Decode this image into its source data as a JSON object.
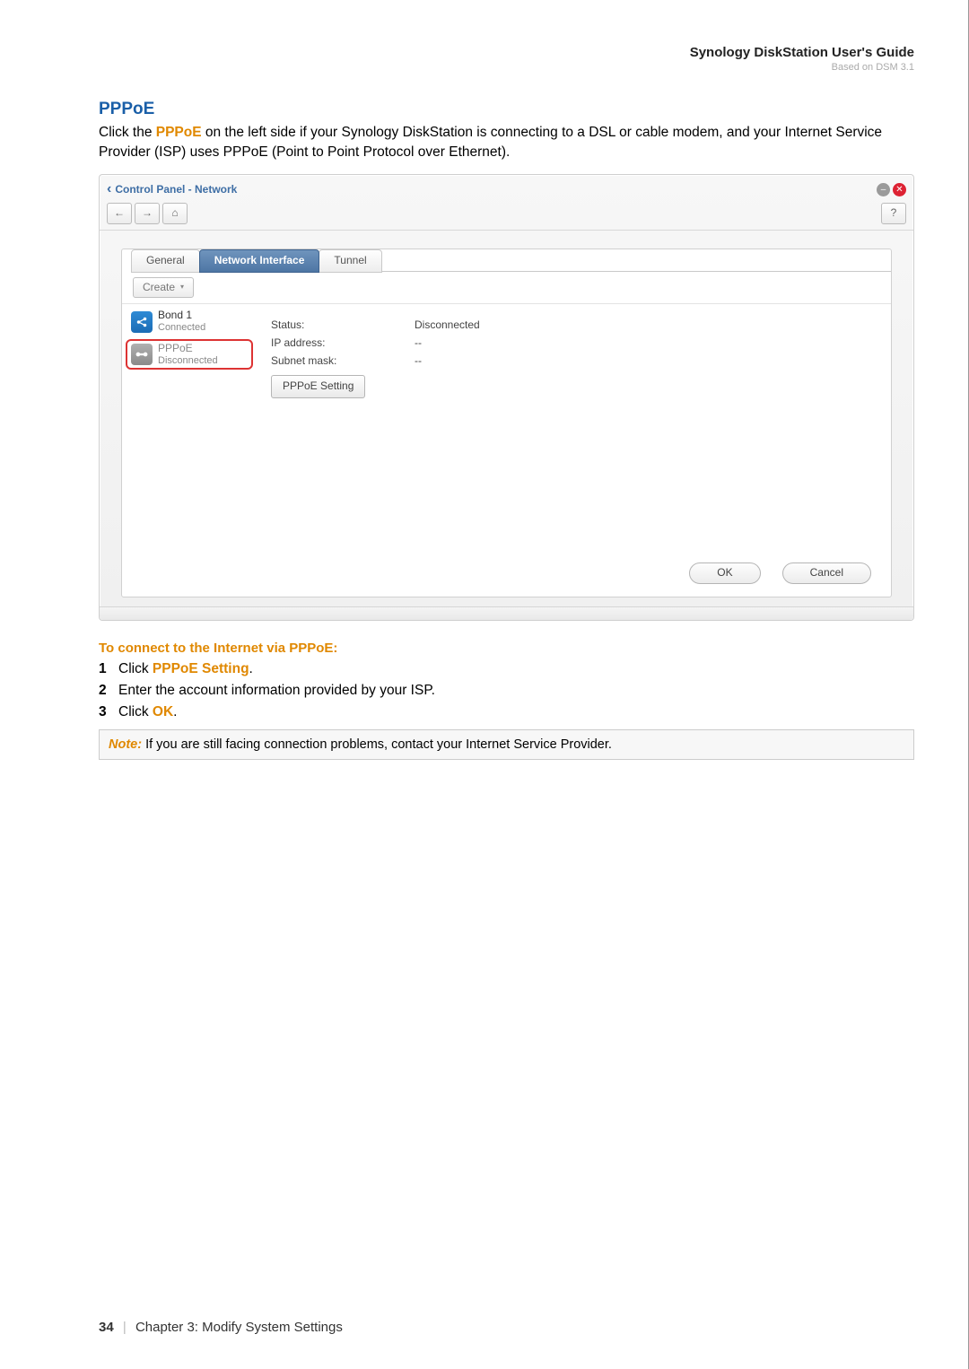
{
  "header": {
    "title": "Synology DiskStation User's Guide",
    "subtitle": "Based on DSM 3.1"
  },
  "section": {
    "title": "PPPoE",
    "intro_pre": "Click the ",
    "intro_link": "PPPoE",
    "intro_post": " on the left side if your Synology DiskStation is connecting to a DSL or cable modem, and your Internet Service Provider (ISP) uses PPPoE (Point to Point Protocol over Ethernet)."
  },
  "window": {
    "title": "Control Panel - Network",
    "tabs": {
      "general": "General",
      "network_interface": "Network Interface",
      "tunnel": "Tunnel"
    },
    "create": "Create",
    "side": {
      "bond": {
        "name": "Bond 1",
        "state": "Connected"
      },
      "pppoe": {
        "name": "PPPoE",
        "state": "Disconnected"
      }
    },
    "fields": {
      "status_label": "Status:",
      "status_value": "Disconnected",
      "ip_label": "IP address:",
      "ip_value": "--",
      "mask_label": "Subnet mask:",
      "mask_value": "--"
    },
    "pppoe_btn": "PPPoE Setting",
    "ok": "OK",
    "cancel": "Cancel"
  },
  "howto": {
    "heading": "To connect to the Internet via PPPoE:",
    "step1_a": "Click ",
    "step1_b": "PPPoE Setting",
    "step1_c": ".",
    "step2": "Enter the account information provided by your ISP.",
    "step3_a": "Click ",
    "step3_b": "OK",
    "step3_c": "."
  },
  "note": {
    "label": "Note:",
    "text": " If you are still facing connection problems, contact your Internet Service Provider."
  },
  "footer": {
    "page": "34",
    "chapter": "Chapter 3: Modify System Settings"
  }
}
